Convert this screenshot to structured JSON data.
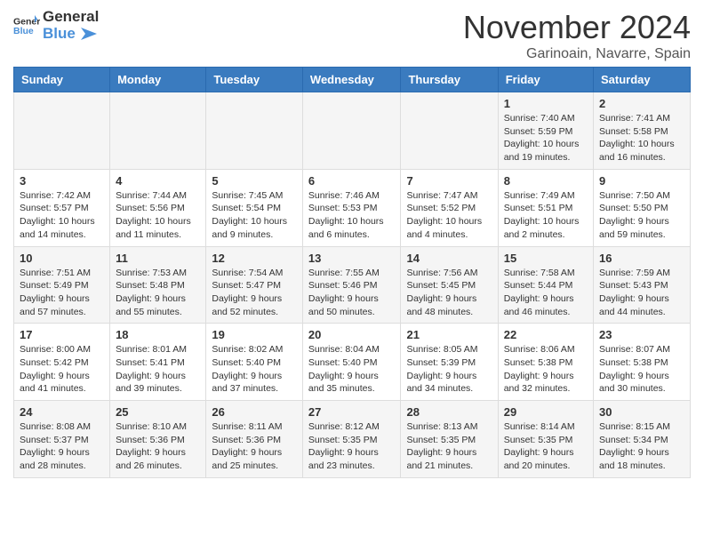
{
  "header": {
    "logo_line1": "General",
    "logo_line2": "Blue",
    "month_year": "November 2024",
    "location": "Garinoain, Navarre, Spain"
  },
  "days_of_week": [
    "Sunday",
    "Monday",
    "Tuesday",
    "Wednesday",
    "Thursday",
    "Friday",
    "Saturday"
  ],
  "weeks": [
    [
      {
        "day": "",
        "info": ""
      },
      {
        "day": "",
        "info": ""
      },
      {
        "day": "",
        "info": ""
      },
      {
        "day": "",
        "info": ""
      },
      {
        "day": "",
        "info": ""
      },
      {
        "day": "1",
        "info": "Sunrise: 7:40 AM\nSunset: 5:59 PM\nDaylight: 10 hours and 19 minutes."
      },
      {
        "day": "2",
        "info": "Sunrise: 7:41 AM\nSunset: 5:58 PM\nDaylight: 10 hours and 16 minutes."
      }
    ],
    [
      {
        "day": "3",
        "info": "Sunrise: 7:42 AM\nSunset: 5:57 PM\nDaylight: 10 hours and 14 minutes."
      },
      {
        "day": "4",
        "info": "Sunrise: 7:44 AM\nSunset: 5:56 PM\nDaylight: 10 hours and 11 minutes."
      },
      {
        "day": "5",
        "info": "Sunrise: 7:45 AM\nSunset: 5:54 PM\nDaylight: 10 hours and 9 minutes."
      },
      {
        "day": "6",
        "info": "Sunrise: 7:46 AM\nSunset: 5:53 PM\nDaylight: 10 hours and 6 minutes."
      },
      {
        "day": "7",
        "info": "Sunrise: 7:47 AM\nSunset: 5:52 PM\nDaylight: 10 hours and 4 minutes."
      },
      {
        "day": "8",
        "info": "Sunrise: 7:49 AM\nSunset: 5:51 PM\nDaylight: 10 hours and 2 minutes."
      },
      {
        "day": "9",
        "info": "Sunrise: 7:50 AM\nSunset: 5:50 PM\nDaylight: 9 hours and 59 minutes."
      }
    ],
    [
      {
        "day": "10",
        "info": "Sunrise: 7:51 AM\nSunset: 5:49 PM\nDaylight: 9 hours and 57 minutes."
      },
      {
        "day": "11",
        "info": "Sunrise: 7:53 AM\nSunset: 5:48 PM\nDaylight: 9 hours and 55 minutes."
      },
      {
        "day": "12",
        "info": "Sunrise: 7:54 AM\nSunset: 5:47 PM\nDaylight: 9 hours and 52 minutes."
      },
      {
        "day": "13",
        "info": "Sunrise: 7:55 AM\nSunset: 5:46 PM\nDaylight: 9 hours and 50 minutes."
      },
      {
        "day": "14",
        "info": "Sunrise: 7:56 AM\nSunset: 5:45 PM\nDaylight: 9 hours and 48 minutes."
      },
      {
        "day": "15",
        "info": "Sunrise: 7:58 AM\nSunset: 5:44 PM\nDaylight: 9 hours and 46 minutes."
      },
      {
        "day": "16",
        "info": "Sunrise: 7:59 AM\nSunset: 5:43 PM\nDaylight: 9 hours and 44 minutes."
      }
    ],
    [
      {
        "day": "17",
        "info": "Sunrise: 8:00 AM\nSunset: 5:42 PM\nDaylight: 9 hours and 41 minutes."
      },
      {
        "day": "18",
        "info": "Sunrise: 8:01 AM\nSunset: 5:41 PM\nDaylight: 9 hours and 39 minutes."
      },
      {
        "day": "19",
        "info": "Sunrise: 8:02 AM\nSunset: 5:40 PM\nDaylight: 9 hours and 37 minutes."
      },
      {
        "day": "20",
        "info": "Sunrise: 8:04 AM\nSunset: 5:40 PM\nDaylight: 9 hours and 35 minutes."
      },
      {
        "day": "21",
        "info": "Sunrise: 8:05 AM\nSunset: 5:39 PM\nDaylight: 9 hours and 34 minutes."
      },
      {
        "day": "22",
        "info": "Sunrise: 8:06 AM\nSunset: 5:38 PM\nDaylight: 9 hours and 32 minutes."
      },
      {
        "day": "23",
        "info": "Sunrise: 8:07 AM\nSunset: 5:38 PM\nDaylight: 9 hours and 30 minutes."
      }
    ],
    [
      {
        "day": "24",
        "info": "Sunrise: 8:08 AM\nSunset: 5:37 PM\nDaylight: 9 hours and 28 minutes."
      },
      {
        "day": "25",
        "info": "Sunrise: 8:10 AM\nSunset: 5:36 PM\nDaylight: 9 hours and 26 minutes."
      },
      {
        "day": "26",
        "info": "Sunrise: 8:11 AM\nSunset: 5:36 PM\nDaylight: 9 hours and 25 minutes."
      },
      {
        "day": "27",
        "info": "Sunrise: 8:12 AM\nSunset: 5:35 PM\nDaylight: 9 hours and 23 minutes."
      },
      {
        "day": "28",
        "info": "Sunrise: 8:13 AM\nSunset: 5:35 PM\nDaylight: 9 hours and 21 minutes."
      },
      {
        "day": "29",
        "info": "Sunrise: 8:14 AM\nSunset: 5:35 PM\nDaylight: 9 hours and 20 minutes."
      },
      {
        "day": "30",
        "info": "Sunrise: 8:15 AM\nSunset: 5:34 PM\nDaylight: 9 hours and 18 minutes."
      }
    ]
  ]
}
